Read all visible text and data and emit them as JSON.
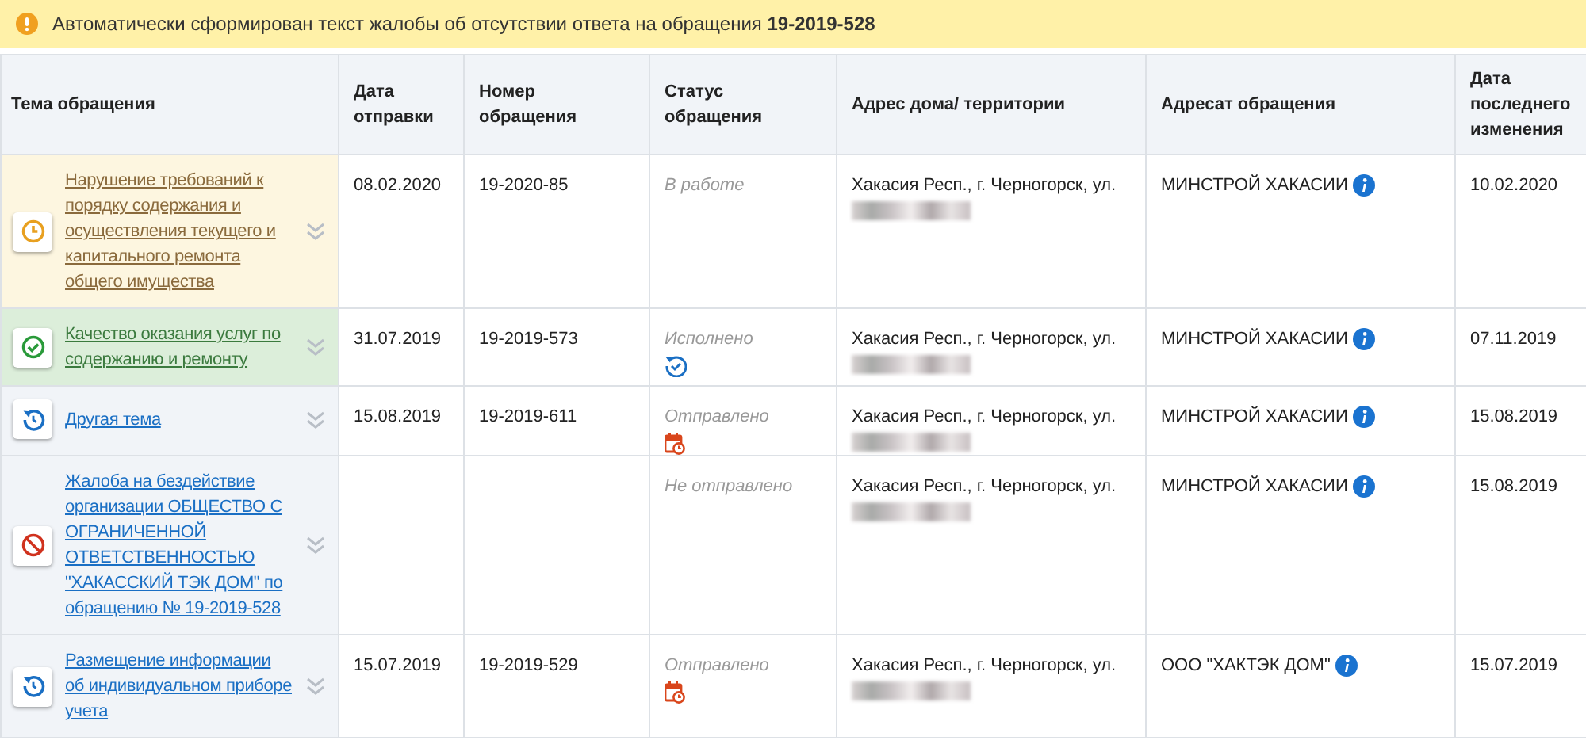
{
  "alert": {
    "text": "Автоматически сформирован текст жалобы об отсутствии ответа на обращения **19-2019-528**"
  },
  "table": {
    "columns": [
      "Тема обращения",
      "Дата отправки",
      "Номер обращения",
      "Статус обращения",
      "Адрес дома/ территории",
      "Адресат обращения",
      "Дата последнего изменения"
    ],
    "rows": [
      {
        "kind": "in_progress",
        "topic": "Нарушение требований к порядку содержания и осуществления текущего и капитального ремонта общего имущества",
        "sent_date": "08.02.2020",
        "number": "19-2020-85",
        "status": {
          "text": "В работе",
          "kind": "none"
        },
        "address": "Хакасия Респ., г. Черногорск, ул.",
        "addressee": "МИНСТРОЙ ХАКАСИИ",
        "changed": "10.02.2020"
      },
      {
        "kind": "done",
        "topic": "Качество оказания услуг по содержанию и ремонту",
        "sent_date": "31.07.2019",
        "number": "19-2019-573",
        "status": {
          "text": "Исполнено",
          "kind": "repeat_check"
        },
        "address": "Хакасия Респ., г. Черногорск, ул.",
        "addressee": "МИНСТРОЙ ХАКАСИИ",
        "changed": "07.11.2019"
      },
      {
        "kind": "sent",
        "topic": "Другая тема",
        "sent_date": "15.08.2019",
        "number": "19-2019-611",
        "status": {
          "text": "Отправлено",
          "kind": "calendar_clock"
        },
        "address": "Хакасия Респ., г. Черногорск, ул.",
        "addressee": "МИНСТРОЙ ХАКАСИИ",
        "changed": "15.08.2019"
      },
      {
        "kind": "not_sent",
        "topic": "Жалоба на бездействие организации ОБЩЕСТВО С ОГРАНИЧЕННОЙ ОТВЕТСТВЕННОСТЬЮ \"ХАКАССКИЙ ТЭК ДОМ\" по обращению № 19-2019-528",
        "status": {
          "text": "Не отправлено",
          "kind": "none"
        },
        "address": "Хакасия Респ., г. Черногорск, ул.",
        "addressee": "МИНСТРОЙ ХАКАСИИ",
        "changed": "15.08.2019"
      },
      {
        "kind": "sent",
        "topic": "Размещение информации об индивидуальном приборе учета",
        "sent_date": "15.07.2019",
        "number": "19-2019-529",
        "status": {
          "text": "Отправлено",
          "kind": "calendar_clock"
        },
        "address": "Хакасия Респ., г. Черногорск, ул.",
        "addressee": "ООО \"ХАКТЭК ДОМ\"",
        "changed": "15.07.2019"
      }
    ]
  }
}
